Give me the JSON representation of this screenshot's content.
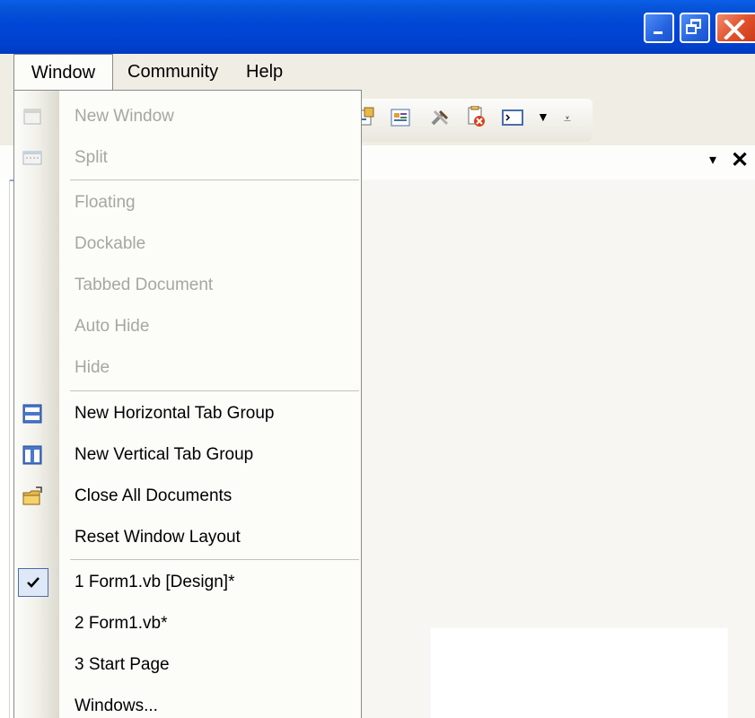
{
  "menubar": {
    "window": "Window",
    "community": "Community",
    "help": "Help"
  },
  "window_menu": {
    "items": [
      {
        "label": "New Window",
        "enabled": false,
        "icon": "new-window-icon"
      },
      {
        "label": "Split",
        "enabled": false,
        "icon": "split-icon"
      },
      {
        "label": "Floating",
        "enabled": false
      },
      {
        "label": "Dockable",
        "enabled": false
      },
      {
        "label": "Tabbed Document",
        "enabled": false
      },
      {
        "label": "Auto Hide",
        "enabled": false
      },
      {
        "label": "Hide",
        "enabled": false
      },
      {
        "label": "New Horizontal Tab Group",
        "enabled": true,
        "icon": "horizontal-tab-group-icon"
      },
      {
        "label": "New Vertical Tab Group",
        "enabled": true,
        "icon": "vertical-tab-group-icon"
      },
      {
        "label": "Close All Documents",
        "enabled": true,
        "icon": "close-all-documents-icon"
      },
      {
        "label": "Reset Window Layout",
        "enabled": true
      },
      {
        "label": "1 Form1.vb [Design]*",
        "enabled": true,
        "checked": true
      },
      {
        "label": "2 Form1.vb*",
        "enabled": true
      },
      {
        "label": "3 Start Page",
        "enabled": true
      },
      {
        "label": "Windows...",
        "enabled": true
      }
    ]
  },
  "tool_window": {
    "dropdown_glyph": "▾",
    "close_glyph": "✕"
  },
  "colors": {
    "titlebar": "#0046d6",
    "menu_background": "#fcfcf9",
    "disabled_text": "#a7a6a0",
    "check_highlight": "#dfe8f6"
  }
}
